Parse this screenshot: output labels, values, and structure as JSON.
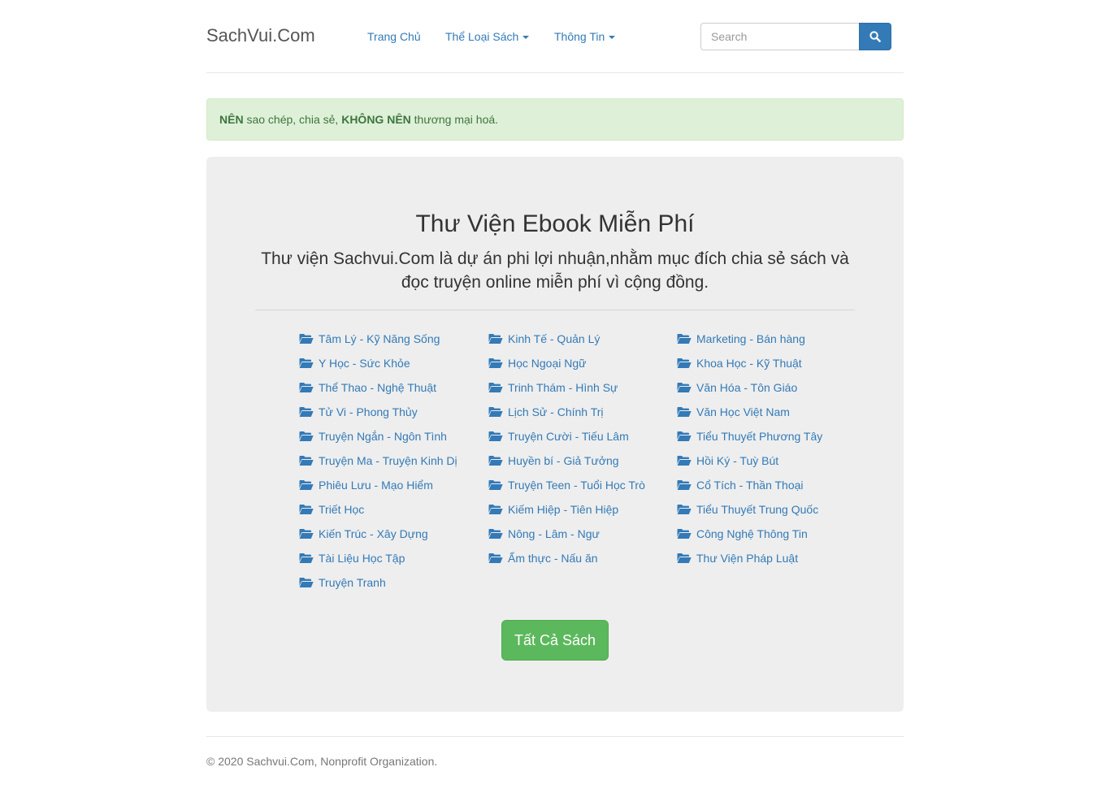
{
  "navbar": {
    "brand": "SachVui.Com",
    "links": [
      {
        "label": "Trang Chủ"
      },
      {
        "label": "Thể Loại Sách"
      },
      {
        "label": "Thông Tin"
      }
    ],
    "search_placeholder": "Search",
    "search_icon": "search-icon"
  },
  "alert": {
    "part1": "NÊN",
    "part2": " sao chép, chia sẻ, ",
    "part3": "KHÔNG NÊN",
    "part4": " thương mại hoá."
  },
  "jumbotron": {
    "title": "Thư Viện Ebook Miễn Phí",
    "description": "Thư viện Sachvui.Com là dự án phi lợi nhuận,nhằm mục đích chia sẻ sách và đọc truyện online miễn phí vì cộng đồng.",
    "category_icon": "folder-open-icon",
    "columns": [
      [
        "Tâm Lý - Kỹ Năng Sống",
        "Y Học - Sức Khỏe",
        "Thể Thao - Nghệ Thuật",
        "Tử Vi - Phong Thủy",
        "Truyện Ngắn - Ngôn Tình",
        "Truyện Ma - Truyện Kinh Dị",
        "Phiêu Lưu - Mạo Hiểm",
        "Triết Học",
        "Kiến Trúc - Xây Dựng",
        "Tài Liệu Học Tập",
        "Truyện Tranh"
      ],
      [
        "Kinh Tế - Quản Lý",
        "Học Ngoại Ngữ",
        "Trinh Thám - Hình Sự",
        "Lịch Sử - Chính Trị",
        "Truyện Cười - Tiếu Lâm",
        "Huyền bí - Giả Tưởng",
        "Truyện Teen - Tuổi Học Trò",
        "Kiếm Hiệp - Tiên Hiệp",
        "Nông - Lâm - Ngư",
        "Ẩm thực - Nấu ăn"
      ],
      [
        "Marketing - Bán hàng",
        "Khoa Học - Kỹ Thuật",
        "Văn Hóa - Tôn Giáo",
        "Văn Học Việt Nam",
        "Tiểu Thuyết Phương Tây",
        "Hồi Ký - Tuỳ Bút",
        "Cổ Tích - Thần Thoại",
        "Tiểu Thuyết Trung Quốc",
        "Công Nghệ Thông Tin",
        "Thư Viện Pháp Luật"
      ]
    ],
    "button_label": "Tất Cả Sách"
  },
  "footer": {
    "text": "© 2020 Sachvui.Com, Nonprofit Organization."
  },
  "colors": {
    "link": "#337ab7",
    "success": "#5cb85c",
    "alert_bg": "#dff0d8",
    "alert_text": "#3c763d",
    "jumbotron_bg": "#eeeeee"
  }
}
